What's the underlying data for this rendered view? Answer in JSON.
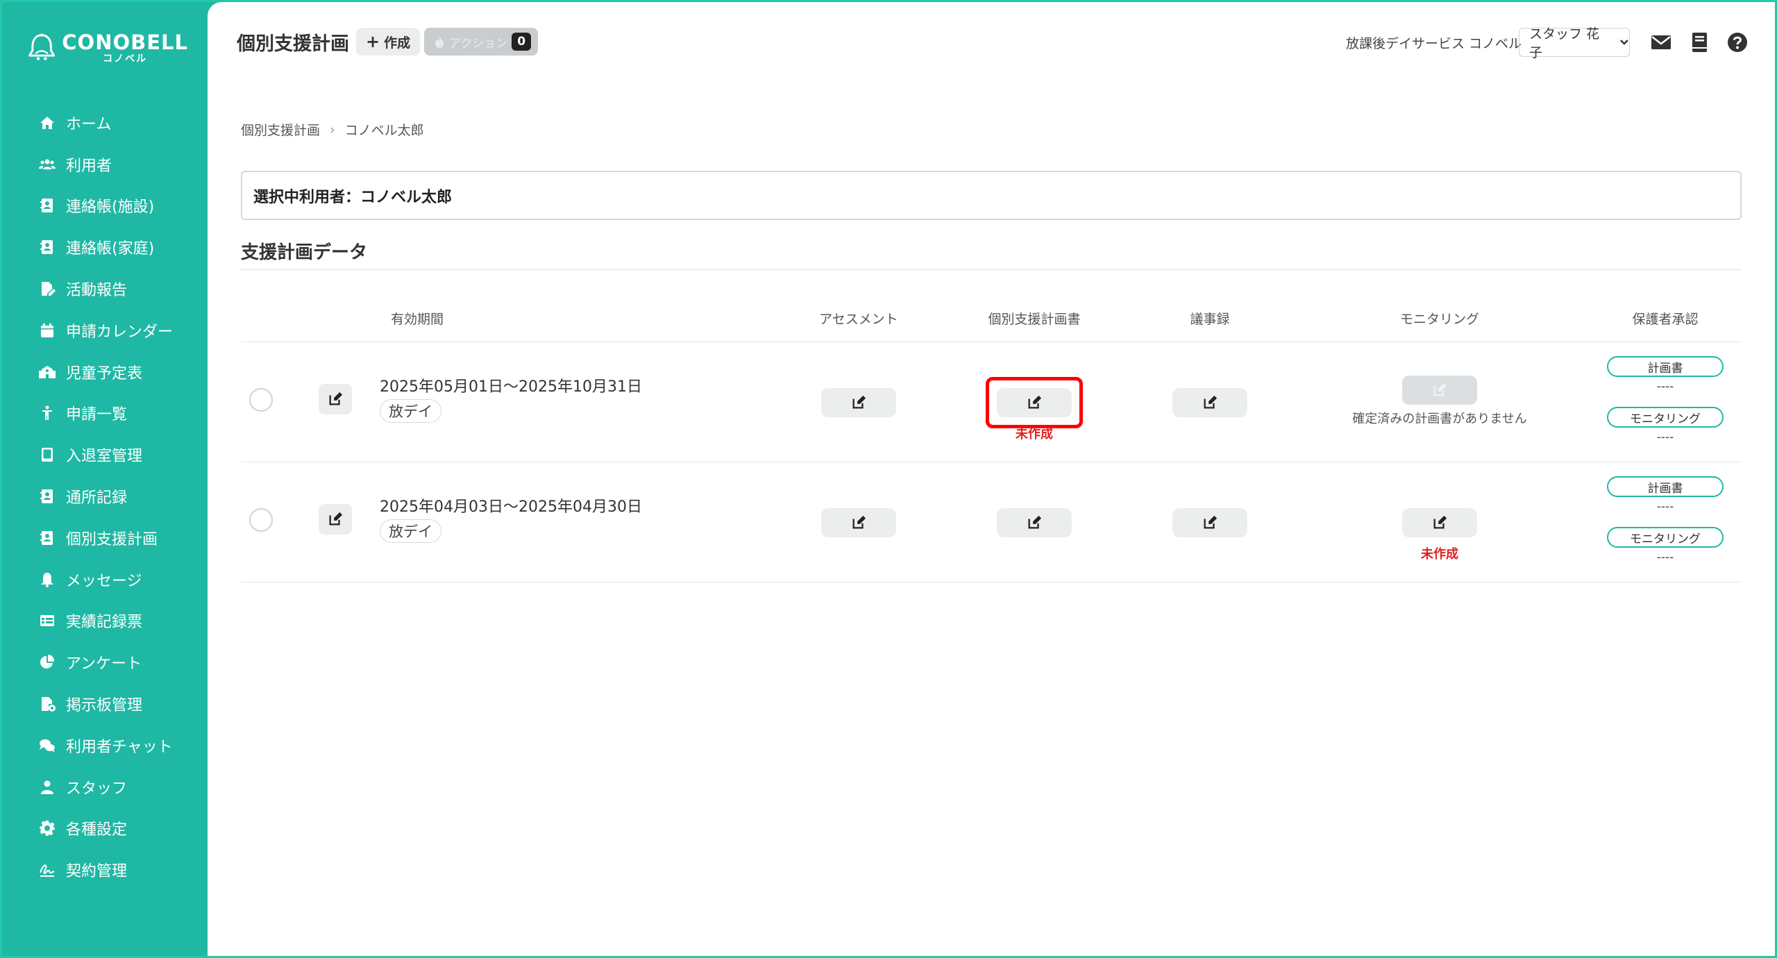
{
  "brand": {
    "name": "CONOBELL",
    "sub": "コノベル"
  },
  "sidebar": {
    "items": [
      {
        "label": "ホーム",
        "icon": "home-icon"
      },
      {
        "label": "利用者",
        "icon": "users-icon"
      },
      {
        "label": "連絡帳(施設)",
        "icon": "contact-book-icon"
      },
      {
        "label": "連絡帳(家庭)",
        "icon": "contact-book-icon"
      },
      {
        "label": "活動報告",
        "icon": "file-edit-icon"
      },
      {
        "label": "申請カレンダー",
        "icon": "calendar-icon"
      },
      {
        "label": "児童予定表",
        "icon": "school-icon"
      },
      {
        "label": "申請一覧",
        "icon": "person-icon"
      },
      {
        "label": "入退室管理",
        "icon": "tablet-icon"
      },
      {
        "label": "通所記録",
        "icon": "contact-book-icon"
      },
      {
        "label": "個別支援計画",
        "icon": "contact-book-icon"
      },
      {
        "label": "メッセージ",
        "icon": "bell-icon"
      },
      {
        "label": "実績記録票",
        "icon": "table-icon"
      },
      {
        "label": "アンケート",
        "icon": "pie-chart-icon"
      },
      {
        "label": "掲示板管理",
        "icon": "file-settings-icon"
      },
      {
        "label": "利用者チャット",
        "icon": "chat-icon"
      },
      {
        "label": "スタッフ",
        "icon": "staff-icon"
      },
      {
        "label": "各種設定",
        "icon": "gear-icon"
      },
      {
        "label": "契約管理",
        "icon": "signature-icon"
      }
    ]
  },
  "header": {
    "title": "個別支援計画",
    "create_label": "作成",
    "action_label": "アクション",
    "action_count": "0",
    "facility": "放課後デイサービス コノベル",
    "staff": "スタッフ 花子"
  },
  "breadcrumb": {
    "parent": "個別支援計画",
    "current": "コノベル太郎"
  },
  "selected_user": "選択中利用者：コノベル太郎",
  "section_title": "支援計画データ",
  "table": {
    "headers": {
      "period": "有効期間",
      "assessment": "アセスメント",
      "plan": "個別支援計画書",
      "minutes": "議事録",
      "monitoring": "モニタリング",
      "approval": "保護者承認"
    },
    "rows": [
      {
        "period": "2025年05月01日〜2025年10月31日",
        "tag": "放デイ",
        "plan_status": "未作成",
        "monitoring_status": "確定済みの計画書がありません",
        "approval_plan_label": "計画書",
        "approval_plan_value": "----",
        "approval_monitoring_label": "モニタリング",
        "approval_monitoring_value": "----"
      },
      {
        "period": "2025年04月03日〜2025年04月30日",
        "tag": "放デイ",
        "monitoring_status": "未作成",
        "approval_plan_label": "計画書",
        "approval_plan_value": "----",
        "approval_monitoring_label": "モニタリング",
        "approval_monitoring_value": "----"
      }
    ]
  },
  "colors": {
    "sidebar": "#1fb8a4",
    "highlight": "#ff0000",
    "status_red": "#e02020"
  }
}
